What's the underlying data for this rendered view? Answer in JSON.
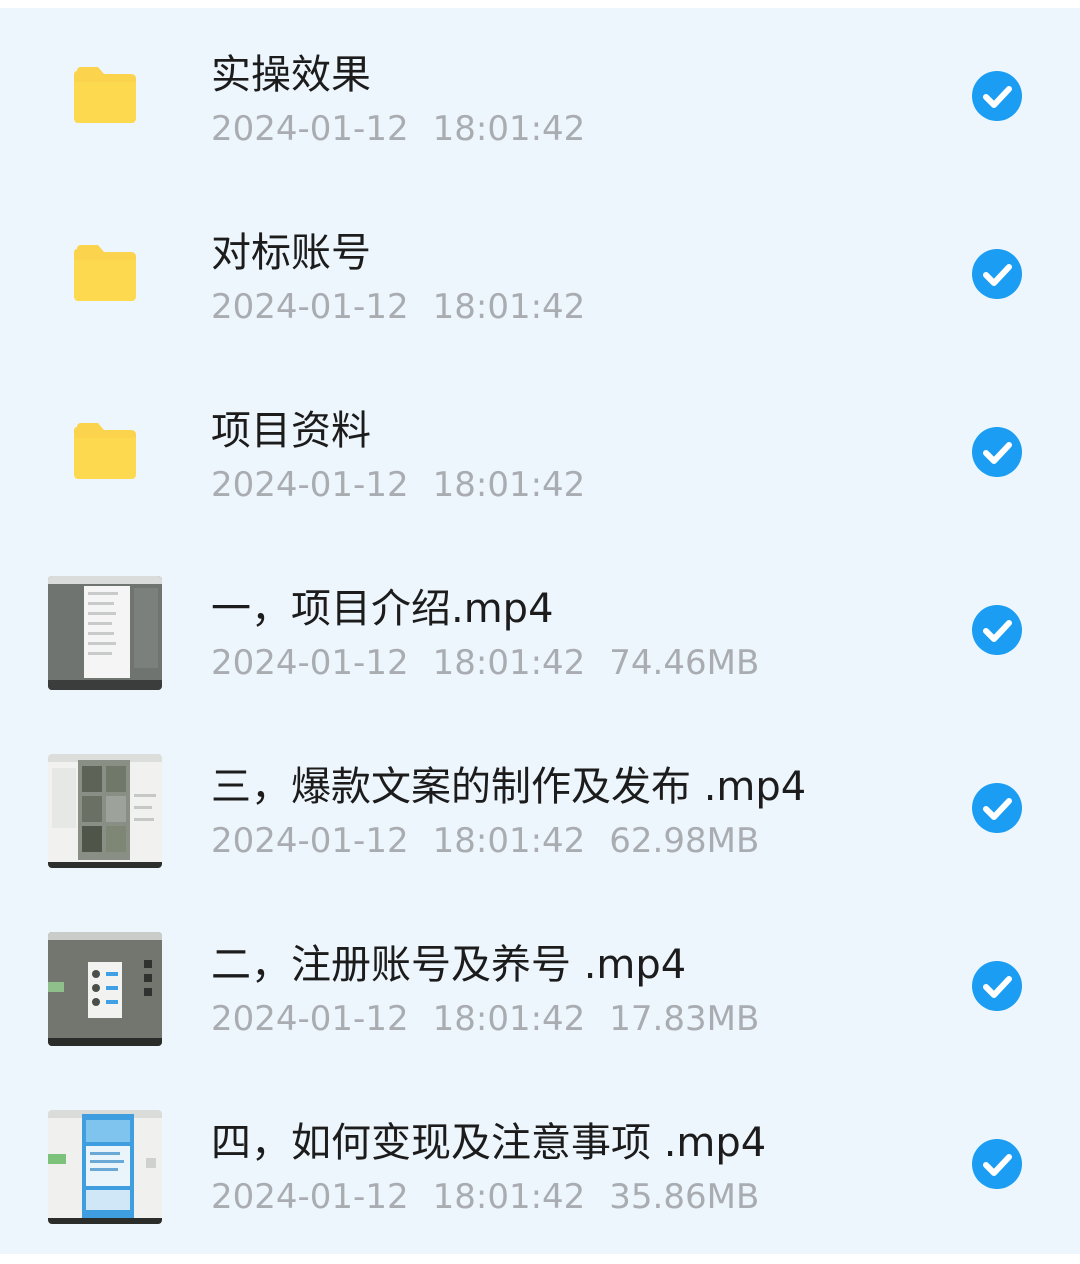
{
  "items": [
    {
      "name": "实操效果",
      "date": "2024-01-12",
      "time": "18:01:42",
      "size": null,
      "icon": "folder-icon",
      "selected": true
    },
    {
      "name": "对标账号",
      "date": "2024-01-12",
      "time": "18:01:42",
      "size": null,
      "icon": "folder-icon",
      "selected": true
    },
    {
      "name": "项目资料",
      "date": "2024-01-12",
      "time": "18:01:42",
      "size": null,
      "icon": "folder-icon",
      "selected": true
    },
    {
      "name": "一，项目介绍.mp4",
      "date": "2024-01-12",
      "time": "18:01:42",
      "size": "74.46MB",
      "icon": "video-thumbnail",
      "selected": true
    },
    {
      "name": "三，爆款文案的制作及发布 .mp4",
      "date": "2024-01-12",
      "time": "18:01:42",
      "size": "62.98MB",
      "icon": "video-thumbnail",
      "selected": true
    },
    {
      "name": "二，注册账号及养号 .mp4",
      "date": "2024-01-12",
      "time": "18:01:42",
      "size": "17.83MB",
      "icon": "video-thumbnail",
      "selected": true
    },
    {
      "name": "四，如何变现及注意事项 .mp4",
      "date": "2024-01-12",
      "time": "18:01:42",
      "size": "35.86MB",
      "icon": "video-thumbnail",
      "selected": true
    }
  ],
  "colors": {
    "list_background": "#eef6fd",
    "folder": "#fcd34d",
    "check": "#1a9df2",
    "name_text": "#1c1c1c",
    "meta_text": "#a9adb2"
  }
}
